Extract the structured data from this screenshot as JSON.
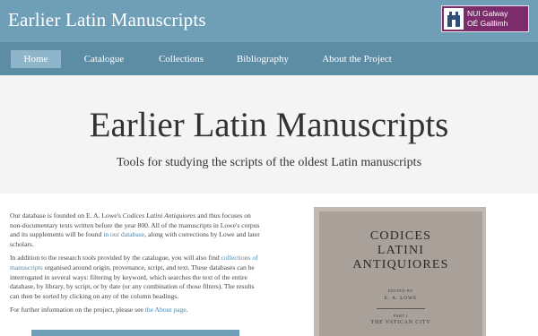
{
  "header": {
    "site_title": "Earlier Latin Manuscripts",
    "logo_line1": "NUI Galway",
    "logo_line2": "OÉ Gaillimh",
    "bar_color": "#6f9fb7",
    "logo_color": "#7c2b6b"
  },
  "nav": {
    "items": [
      {
        "label": "Home",
        "active": true
      },
      {
        "label": "Catalogue",
        "active": false
      },
      {
        "label": "Collections",
        "active": false
      },
      {
        "label": "Bibliography",
        "active": false
      },
      {
        "label": "About the Project",
        "active": false
      }
    ],
    "bar_color": "#5d8ca5",
    "active_color": "#8eb5c9"
  },
  "hero": {
    "title": "Earlier Latin Manuscripts",
    "subtitle": "Tools for studying the scripts of the oldest Latin manuscripts"
  },
  "content": {
    "p1_a": "Our database is founded on E. A. Lowe's ",
    "p1_italic": "Codices Latini Antiquiores",
    "p1_b": " and thus focuses on non-documentary texts written before the year 800. All of the manuscripts in Lowe's corpus and its supplements will be found ",
    "p1_link": "in our database",
    "p1_c": ", along with corrections by Lowe and later scholars.",
    "p2_a": "In addition to the research tools provided by the catalogue, you will also find ",
    "p2_link": "collections of manuscripts",
    "p2_b": " organised around origin, provenance, script, and text. These databases can be interrogated in several ways: filtering by keyword, which searches the text of the entire database, by library, by script, or by date (or any combination of those filters). The results can then be sorted by clicking on any of the column headings.",
    "p3_a": "For further information on the project, please see ",
    "p3_link": "the About page",
    "p3_b": ".",
    "link_color": "#4c87ad"
  },
  "book": {
    "title_line1": "CODICES",
    "title_line2": "LATINI",
    "title_line3": "ANTIQUIORES",
    "edited_by": "EDITED BY",
    "editor": "E. A. LOWE",
    "part": "PART I",
    "volume": "THE VATICAN CITY"
  }
}
